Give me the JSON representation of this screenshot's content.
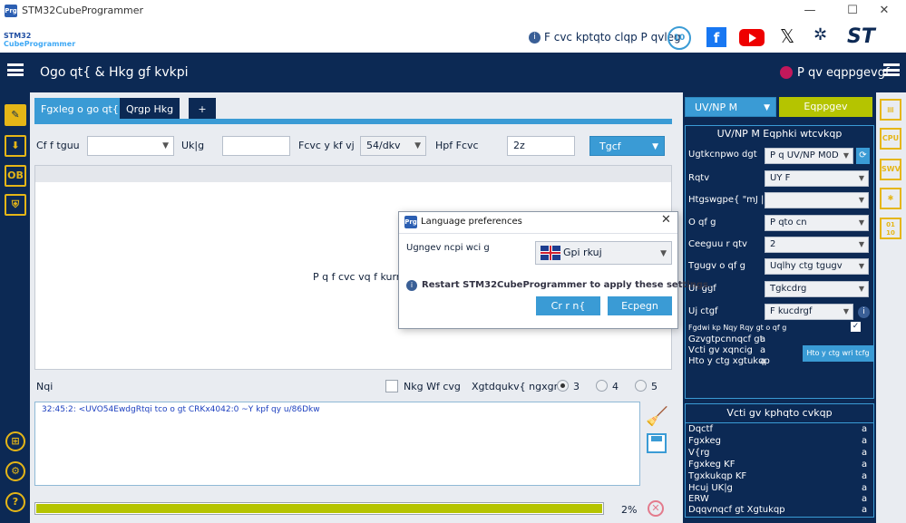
{
  "window": {
    "title": "STM32CubeProgrammer",
    "logo_text": "Prg",
    "minimize": "—",
    "maximize": "☐",
    "close": "✕"
  },
  "brand": {
    "logo_line1": "STM32",
    "logo_line2": "CubeProgrammer",
    "config_text": "F cvc kptqto clqp P qvleg",
    "anniversary": "10"
  },
  "header": {
    "title": "Ogo qt{ & Hkg gf kvkpi",
    "connection": "P qv eqppgevgf"
  },
  "tabs": [
    {
      "label": "Fgxleg o go qt{"
    },
    {
      "label": "Qrgp Hkg"
    },
    {
      "label": "+"
    }
  ],
  "toolbar": {
    "address_label": "Cf f tguu",
    "address_value": "",
    "size_label": "Uk|g",
    "size_value": "",
    "width_label": "Fcvc y kf vj",
    "width_value": "54/dkv",
    "find_label": "Hpf Fcvc",
    "find_value": "2z",
    "read_button": "Tgcf"
  },
  "memory_area": {
    "message": "P q f cvc vq f kurnc{"
  },
  "log_controls": {
    "log_label": "Nqi",
    "live_update": "Nkg Wf cvg",
    "verbosity_label": "Xgtdqukv{ ngxgn",
    "levels": [
      "3",
      "4",
      "5"
    ],
    "selected_level": "3"
  },
  "log": {
    "line": "32:45:2:  <UVO54EwdgRtqi tco o gt CRKx4042:0 ~Y kpf qy u/86Dkw"
  },
  "progress": {
    "value": 0.99,
    "percent_text": "2%"
  },
  "right": {
    "interface": "UV/NP M",
    "connect_button": "Eqppgev",
    "config_title": "UV/NP M Eqphki wtcvkqp",
    "fields": [
      {
        "label": "Ugtkcnpwo dgt",
        "value": "P q UV/NP M0D"
      },
      {
        "label": "Rqtv",
        "value": "UY F"
      },
      {
        "label": "Htgswgpe{ \"mJ | +",
        "value": ""
      },
      {
        "label": "O qf g",
        "value": "P qto cn"
      },
      {
        "label": "Ceeguu r qtv",
        "value": "2"
      },
      {
        "label": "Tgugv o qf g",
        "value": "Uqlhy ctg tgugv"
      },
      {
        "label": "Ur ggf",
        "value": "Tgkcdrg"
      },
      {
        "label": "Uj ctgf",
        "value": "F kucdrgf"
      }
    ],
    "debug_low_power": "Fgdwi  kp Nqy  Rqy gt o qf g",
    "ext_loader": "Gzvgtpcnnqcf gt",
    "target_voltage": "Vcti gv xqncig",
    "fw_version": "Hto y ctg xgtukqp",
    "na": "a",
    "fw_button": "Hto y ctg wri tcfg",
    "target_title": "Vcti gv kphqto cvkqp",
    "target_rows": [
      "Dqctf",
      "Fgxkeg",
      "V{rg",
      "Fgxkeg KF",
      "Tgxkukqp KF",
      "Hcuj UK|g",
      "ERW",
      "Dqqvnqcf gt Xgtukqp"
    ]
  },
  "side_tabs": [
    "CPU",
    "SWV",
    "01 10"
  ],
  "dialog": {
    "logo_text": "Prg",
    "title": "Language preferences",
    "language_label": "Ugngev ncpi wci g",
    "language_value": "Gpi rkuj",
    "info": "Restart STM32CubeProgrammer to apply these settings.",
    "apply": "Cr r n{",
    "cancel": "Ecpegn"
  },
  "colors": {
    "navy": "#0c2954",
    "blue": "#3a9bd5",
    "yellow_green": "#b5c400",
    "accent": "#e5b617"
  }
}
